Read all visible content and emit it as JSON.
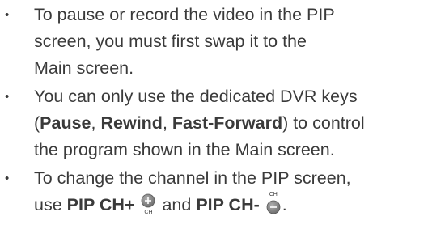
{
  "bullet_glyph": "•",
  "notes": [
    {
      "lines": [
        [
          "To pause or record the video in the PIP"
        ],
        [
          "screen, you must first swap it to the"
        ],
        [
          "Main screen."
        ]
      ]
    },
    {
      "parts": {
        "l1": "You can only use the dedicated DVR keys",
        "l2_open": "(",
        "pause": "Pause",
        "sep1": ", ",
        "rewind": "Rewind",
        "sep2": ", ",
        "ff": "Fast-Forward",
        "l2_close": ") to control",
        "l3": "the program shown in the Main screen."
      }
    },
    {
      "parts": {
        "l1": "To change the channel in the PIP screen,",
        "use": "use ",
        "pip_ch_plus": "PIP CH+",
        "and": " and ",
        "pip_ch_minus": "PIP CH-",
        "end": "."
      }
    }
  ],
  "icons": {
    "ch_plus_button": {
      "symbol": "+",
      "caption": "CH",
      "name": "ch-plus-button-icon"
    },
    "ch_minus_button": {
      "symbol": "−",
      "caption": "CH",
      "name": "ch-minus-button-icon"
    }
  },
  "colors": {
    "text": "#3a3a3a",
    "button_fill": "#7a7a7a",
    "button_symbol": "#ffffff"
  }
}
